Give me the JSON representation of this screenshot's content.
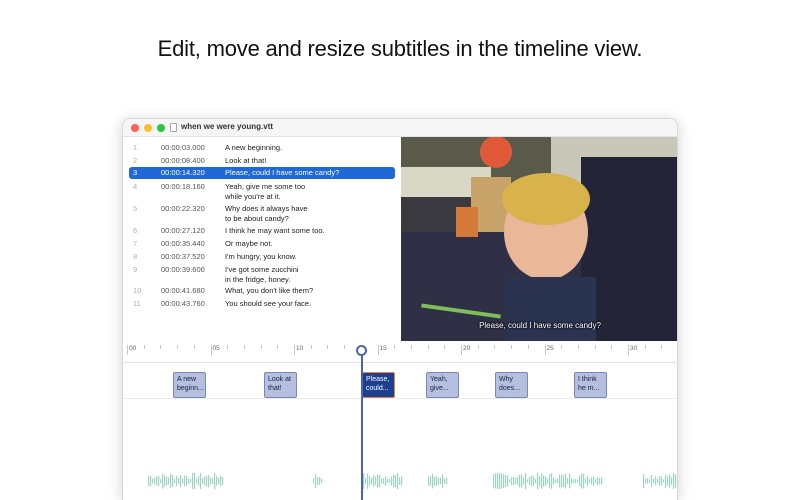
{
  "headline": "Edit, move and resize subtitles in the timeline view.",
  "window": {
    "title": "when we were young.vtt"
  },
  "subtitles": [
    {
      "num": "1",
      "time": "00:00:03.000",
      "line1": "A new beginning.",
      "line2": ""
    },
    {
      "num": "2",
      "time": "00:00:08.400",
      "line1": "Look at that!",
      "line2": ""
    },
    {
      "num": "3",
      "time": "00:00:14.320",
      "line1": "Please, could I have some candy?",
      "line2": ""
    },
    {
      "num": "4",
      "time": "00:00:18.160",
      "line1": "Yeah, give me some too",
      "line2": "while you're at it."
    },
    {
      "num": "5",
      "time": "00:00:22.320",
      "line1": "Why does it always have",
      "line2": "to be about candy?"
    },
    {
      "num": "6",
      "time": "00:00:27.120",
      "line1": "I think he may want some too.",
      "line2": ""
    },
    {
      "num": "7",
      "time": "00:00:35.440",
      "line1": "Or maybe not.",
      "line2": ""
    },
    {
      "num": "8",
      "time": "00:00:37.520",
      "line1": "I'm hungry, you know.",
      "line2": ""
    },
    {
      "num": "9",
      "time": "00:00:39.600",
      "line1": "I've got some zucchini",
      "line2": "in the fridge, honey."
    },
    {
      "num": "10",
      "time": "00:00:41.680",
      "line1": "What, you don't like them?",
      "line2": ""
    },
    {
      "num": "11",
      "time": "00:00:43.760",
      "line1": "You should see your face.",
      "line2": ""
    }
  ],
  "selected_index": 2,
  "video": {
    "caption": "Please, could I have some candy?"
  },
  "timeline": {
    "ruler_labels": [
      "00",
      "05",
      "10",
      "15",
      "20",
      "25",
      "30"
    ],
    "blocks": [
      {
        "line1": "A new",
        "line2": "beginn..."
      },
      {
        "line1": "Look at",
        "line2": "that!"
      },
      {
        "line1": "Please,",
        "line2": "could..."
      },
      {
        "line1": "Yeah,",
        "line2": "give..."
      },
      {
        "line1": "Why",
        "line2": "does..."
      },
      {
        "line1": "I think",
        "line2": "he m..."
      }
    ],
    "playhead_seconds": 14.3
  },
  "colors": {
    "selection": "#1f68d6",
    "block": "#b5bfe0",
    "block_active": "#1c3f8f",
    "waveform": "#9fd3c3",
    "playhead": "#4b63b0"
  }
}
